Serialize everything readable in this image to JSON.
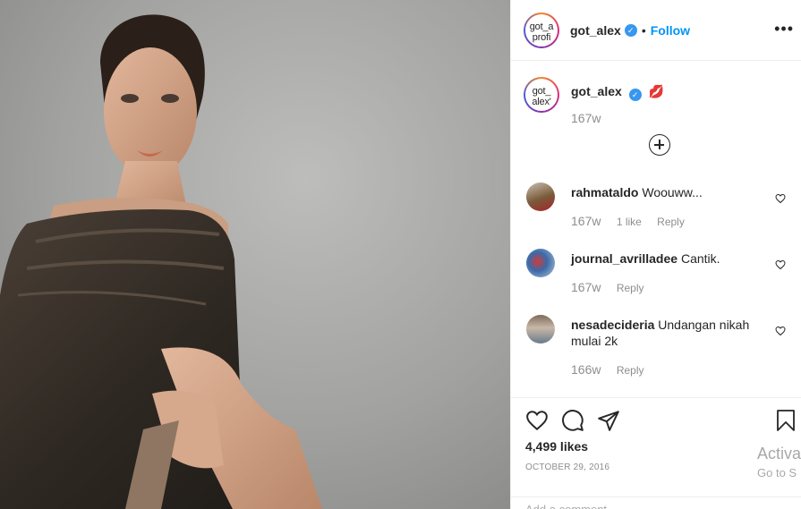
{
  "header": {
    "avatar_text": "got_a profi",
    "username": "got_alex",
    "separator": "•",
    "follow_label": "Follow",
    "more_label": "•••"
  },
  "caption": {
    "avatar_text": "got_ alex'",
    "username": "got_alex",
    "emoji": "💋",
    "time": "167w"
  },
  "comments": [
    {
      "username": "rahmataldo",
      "text": "Woouww...",
      "time": "167w",
      "likes": "1 like",
      "reply": "Reply"
    },
    {
      "username": "journal_avrilladee",
      "text": "Cantik.",
      "time": "167w",
      "likes": "",
      "reply": "Reply"
    },
    {
      "username": "nesadecideria",
      "text": "Undangan nikah mulai 2k",
      "time": "166w",
      "likes": "",
      "reply": "Reply"
    }
  ],
  "actions": {
    "likes_count": "4,499 likes",
    "date": "OCTOBER 29, 2016",
    "add_comment_placeholder": "Add a comment..."
  },
  "overlay": {
    "line1": "Activa",
    "line2": "Go to S"
  },
  "icons": [
    "like-icon",
    "comment-icon",
    "share-icon",
    "save-icon",
    "verified-icon",
    "load-more-icon",
    "heart-icon"
  ],
  "colors": {
    "accent": "#0095f6",
    "verified": "#3897f0",
    "muted": "#8e8e8e"
  }
}
